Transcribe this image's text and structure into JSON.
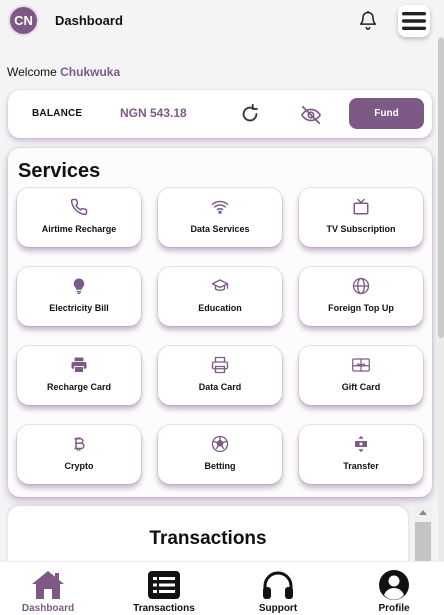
{
  "header": {
    "avatar_initials": "CN",
    "title": "Dashboard",
    "icons": [
      "bell-icon",
      "menu-icon"
    ]
  },
  "welcome": {
    "prefix": "Welcome",
    "name": "Chukwuka"
  },
  "balance": {
    "label": "BALANCE",
    "value": "NGN 543.18",
    "fund_label": "Fund",
    "icons": [
      "refresh-icon",
      "eye-off-icon"
    ]
  },
  "services": {
    "title": "Services",
    "items": [
      {
        "label": "Airtime Recharge",
        "icon": "phone-icon"
      },
      {
        "label": "Data Services",
        "icon": "wifi-icon"
      },
      {
        "label": "TV Subscription",
        "icon": "tv-icon"
      },
      {
        "label": "Electricity Bill",
        "icon": "bulb-icon"
      },
      {
        "label": "Education",
        "icon": "graduation-cap-icon"
      },
      {
        "label": "Foreign Top Up",
        "icon": "globe-icon"
      },
      {
        "label": "Recharge Card",
        "icon": "printer-icon"
      },
      {
        "label": "Data Card",
        "icon": "printer-outline-icon"
      },
      {
        "label": "Gift Card",
        "icon": "gift-card-icon"
      },
      {
        "label": "Crypto",
        "icon": "bitcoin-icon"
      },
      {
        "label": "Betting",
        "icon": "soccer-ball-icon"
      },
      {
        "label": "Transfer",
        "icon": "transfer-icon"
      }
    ]
  },
  "transactions": {
    "title": "Transactions"
  },
  "bottom_nav": {
    "items": [
      {
        "label": "Dashboard",
        "icon": "home-icon",
        "active": true
      },
      {
        "label": "Transactions",
        "icon": "list-icon",
        "active": false
      },
      {
        "label": "Support",
        "icon": "headphones-icon",
        "active": false
      },
      {
        "label": "Profile",
        "icon": "user-circle-icon",
        "active": false
      }
    ]
  },
  "colors": {
    "accent": "#7d5a86",
    "background": "#f4f4f6"
  }
}
